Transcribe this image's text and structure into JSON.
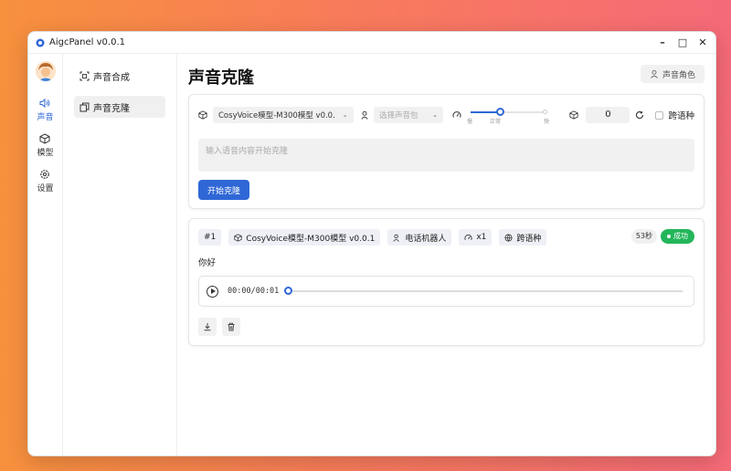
{
  "window": {
    "title": "AigcPanel v0.0.1",
    "controls": [
      "–",
      "□",
      "✕"
    ]
  },
  "rail": {
    "items": [
      {
        "label": "声音",
        "icon": "sound-icon",
        "active": true
      },
      {
        "label": "模型",
        "icon": "cube-icon",
        "active": false
      },
      {
        "label": "设置",
        "icon": "gear-icon",
        "active": false
      }
    ]
  },
  "subnav": {
    "items": [
      {
        "label": "声音合成",
        "icon": "scan-icon",
        "active": false
      },
      {
        "label": "声音克隆",
        "icon": "copy-icon",
        "active": true
      }
    ]
  },
  "main": {
    "title": "声音克隆",
    "role_button": "声音角色"
  },
  "form": {
    "model_select": "CosyVoice模型-M300模型 v0.0.",
    "voice_select_placeholder": "选择声音包",
    "speed": {
      "min_label": "慢",
      "mid_label": "正常",
      "max_label": "快",
      "level": 0.5
    },
    "seed_value": "0",
    "cross_lingual_label": "跨语种",
    "cross_lingual_checked": false,
    "text_placeholder": "输入语音内容开始克隆",
    "start_button": "开始克隆"
  },
  "result": {
    "index": "#1",
    "model": "CosyVoice模型-M300模型 v0.0.1",
    "voice": "电话机器人",
    "speed": "x1",
    "mode": "跨语种",
    "duration": "53秒",
    "status": "成功",
    "text": "你好",
    "player_time": "00:00/00:01",
    "progress": 0
  },
  "colors": {
    "accent": "#2f67d6",
    "success": "#23b65a"
  }
}
